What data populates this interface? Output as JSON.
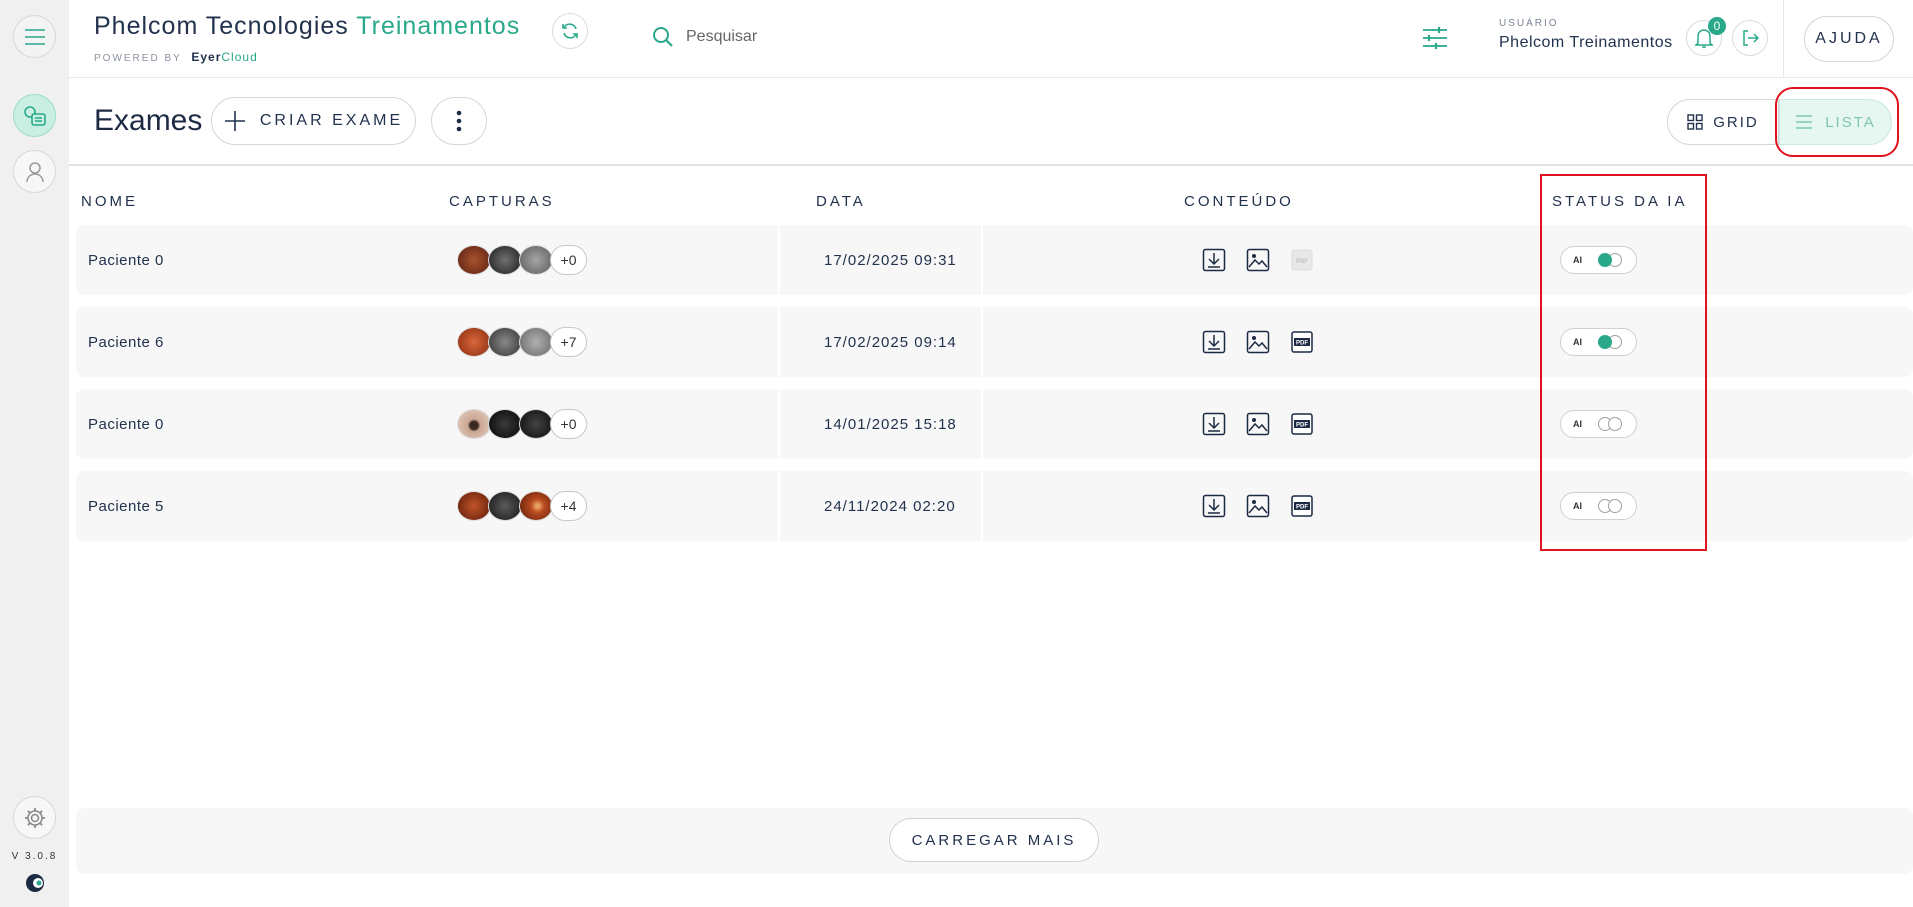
{
  "header": {
    "brand_main": "Phelcom Tecnologies",
    "brand_accent": "Treinamentos",
    "powered_by": "POWERED BY",
    "powered_brand_a": "Eyer",
    "powered_brand_b": "Cloud",
    "search_placeholder": "Pesquisar",
    "user_label": "USUÁRIO",
    "user_name": "Phelcom Treinamentos",
    "notifications_count": "0",
    "help_label": "AJUDA"
  },
  "sidebar": {
    "version": "V 3.0.8"
  },
  "toolbar": {
    "title": "Exames",
    "create_label": "CRIAR EXAME",
    "grid_label": "GRID",
    "list_label": "LISTA"
  },
  "table": {
    "columns": [
      "NOME",
      "CAPTURAS",
      "DATA",
      "CONTEÚDO",
      "STATUS DA IA"
    ],
    "rows": [
      {
        "name": "Paciente 0",
        "extra": "+0",
        "date": "17/02/2025 09:31",
        "ai_label": "AI",
        "ai_enabled": true,
        "pdf_available": false
      },
      {
        "name": "Paciente 6",
        "extra": "+7",
        "date": "17/02/2025 09:14",
        "ai_label": "AI",
        "ai_enabled": true,
        "pdf_available": true
      },
      {
        "name": "Paciente 0",
        "extra": "+0",
        "date": "14/01/2025 15:18",
        "ai_label": "AI",
        "ai_enabled": false,
        "pdf_available": true
      },
      {
        "name": "Paciente 5",
        "extra": "+4",
        "date": "24/11/2024 02:20",
        "ai_label": "AI",
        "ai_enabled": false,
        "pdf_available": true
      }
    ]
  },
  "footer": {
    "load_more_label": "CARREGAR MAIS"
  },
  "colors": {
    "accent": "#2aa88a",
    "highlight": "#e0121e"
  }
}
